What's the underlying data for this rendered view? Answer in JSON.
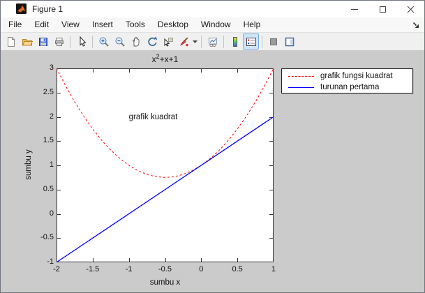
{
  "window": {
    "title": "Figure 1",
    "controls": {
      "minimize": "minimize",
      "maximize": "maximize",
      "close": "close"
    }
  },
  "menu": {
    "items": [
      "File",
      "Edit",
      "View",
      "Insert",
      "Tools",
      "Desktop",
      "Window",
      "Help"
    ]
  },
  "toolbar": {
    "buttons": [
      "new-figure",
      "open-file",
      "save-figure",
      "print-figure",
      "pointer",
      "zoom-in",
      "zoom-out",
      "pan",
      "rotate-3d",
      "data-cursor",
      "brush-data",
      "brush-dropdown",
      "link-plot",
      "insert-colorbar",
      "insert-legend",
      "hide-plot-tools",
      "show-plot-tools"
    ],
    "active_button": "insert-legend"
  },
  "colors": {
    "figure_background": "#cbcbcb",
    "axes_background": "#ffffff",
    "quadratic_line": "#ff0000",
    "derivative_line": "#0000ff",
    "legend_active_button": "#cfe4f7"
  },
  "chart_data": {
    "type": "line",
    "title": "x^2+x+1",
    "title_parts": {
      "base": "x",
      "sup": "2",
      "rest": "+x+1"
    },
    "xlabel": "sumbu x",
    "ylabel": "sumbu y",
    "xlim": [
      -2,
      1
    ],
    "ylim": [
      -1,
      3
    ],
    "xticks": [
      -2,
      -1.5,
      -1,
      -0.5,
      0,
      0.5,
      1
    ],
    "xtick_labels": [
      "-2",
      "-1.5",
      "-1",
      "-0.5",
      "0",
      "0.5",
      "1"
    ],
    "yticks": [
      -1,
      -0.5,
      0,
      0.5,
      1,
      1.5,
      2,
      2.5,
      3
    ],
    "ytick_labels": [
      "-1",
      "-0.5",
      "0",
      "0.5",
      "1",
      "1.5",
      "2",
      "2.5",
      "3"
    ],
    "grid": false,
    "legend_position": "outside-top-right",
    "series": [
      {
        "name": "grafik fungsi kuadrat",
        "color": "#ff0000",
        "style": "dashed",
        "width": 1,
        "x": [
          -2,
          -1.875,
          -1.75,
          -1.625,
          -1.5,
          -1.375,
          -1.25,
          -1.125,
          -1,
          -0.875,
          -0.75,
          -0.625,
          -0.5,
          -0.375,
          -0.25,
          -0.125,
          0,
          0.125,
          0.25,
          0.375,
          0.5,
          0.625,
          0.75,
          0.875,
          1
        ],
        "y": [
          3,
          2.640625,
          2.3125,
          2.015625,
          1.75,
          1.515625,
          1.3125,
          1.140625,
          1,
          0.890625,
          0.8125,
          0.765625,
          0.75,
          0.765625,
          0.8125,
          0.890625,
          1,
          1.140625,
          1.3125,
          1.515625,
          1.75,
          2.015625,
          2.3125,
          2.640625,
          3
        ]
      },
      {
        "name": "turunan pertama",
        "color": "#0000ff",
        "style": "solid",
        "width": 1.3,
        "x": [
          -2,
          1
        ],
        "y": [
          -1,
          2
        ]
      }
    ],
    "annotations": [
      {
        "text": "grafik kuadrat",
        "x": -1,
        "y": 2
      }
    ]
  }
}
